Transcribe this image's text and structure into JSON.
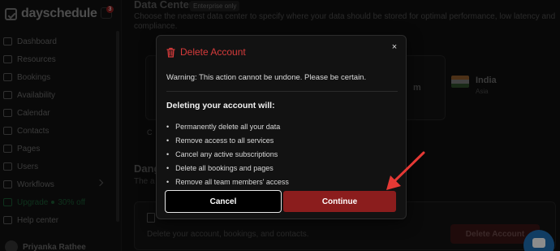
{
  "app": {
    "name": "dayschedule",
    "notification_count": "3"
  },
  "sidebar": {
    "items": [
      {
        "label": "Dashboard",
        "icon": "dashboard-icon"
      },
      {
        "label": "Resources",
        "icon": "folder-icon"
      },
      {
        "label": "Bookings",
        "icon": "bookings-icon"
      },
      {
        "label": "Availability",
        "icon": "availability-icon"
      },
      {
        "label": "Calendar",
        "icon": "calendar-icon"
      },
      {
        "label": "Contacts",
        "icon": "contacts-icon"
      },
      {
        "label": "Pages",
        "icon": "pages-icon"
      },
      {
        "label": "Users",
        "icon": "users-icon"
      },
      {
        "label": "Workflows",
        "icon": "workflows-icon"
      },
      {
        "label": "Upgrade",
        "extra": "30% off",
        "icon": "upgrade-icon"
      },
      {
        "label": "Help center",
        "icon": "help-icon"
      }
    ],
    "profile_name": "Priyanka Rathee"
  },
  "main": {
    "data_center_title": "Data Center",
    "enterprise_badge": "Enterprise only",
    "data_center_desc": "Choose the nearest data center to specify where your data should be stored for optimal performance, low latency and compliance.",
    "region": {
      "name": "India",
      "sub": "Asia"
    },
    "danger_title": "Dang",
    "danger_sub": "The a",
    "delete_desc": "Delete your account, bookings, and contacts.",
    "delete_button": "Delete Account"
  },
  "modal": {
    "title": "Delete Account",
    "close": "×",
    "warning": "Warning: This action cannot be undone. Please be certain.",
    "list_title": "Deleting your account will:",
    "items": [
      "Permanently delete all your data",
      "Remove access to all services",
      "Cancel any active subscriptions",
      "Delete all bookings and pages",
      "Remove all team members' access"
    ],
    "cancel_label": "Cancel",
    "continue_label": "Continue"
  },
  "colors": {
    "danger": "#d63b3b",
    "continue_bg": "#8b1d1d",
    "arrow": "#e53935",
    "chat": "#1f6fb5"
  }
}
